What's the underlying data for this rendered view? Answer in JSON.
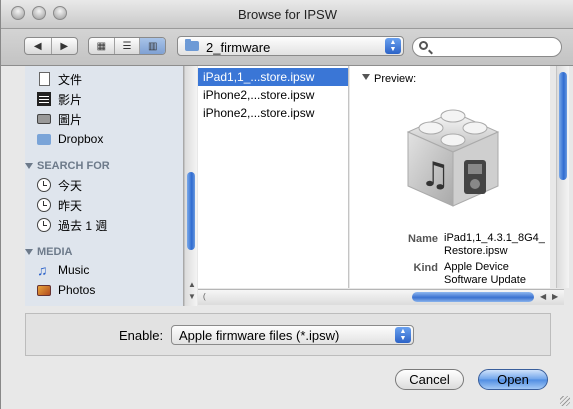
{
  "window": {
    "title": "Browse for IPSW"
  },
  "toolbar": {
    "back_icon": "chevron-left-icon",
    "forward_icon": "chevron-right-icon",
    "view_modes": [
      "icon-view",
      "list-view",
      "column-view"
    ],
    "active_view": "column-view",
    "location": "2_firmware",
    "search_placeholder": ""
  },
  "sidebar": {
    "places": [
      {
        "label": "文件",
        "icon": "document-icon"
      },
      {
        "label": "影片",
        "icon": "film-icon"
      },
      {
        "label": "圖片",
        "icon": "camera-icon"
      },
      {
        "label": "Dropbox",
        "icon": "dropbox-folder-icon"
      }
    ],
    "search_header": "SEARCH FOR",
    "search_items": [
      {
        "label": "今天",
        "icon": "clock-icon"
      },
      {
        "label": "昨天",
        "icon": "clock-icon"
      },
      {
        "label": "過去 1 週",
        "icon": "clock-icon"
      }
    ],
    "media_header": "MEDIA",
    "media_items": [
      {
        "label": "Music",
        "icon": "music-note-icon"
      },
      {
        "label": "Photos",
        "icon": "photos-icon"
      }
    ]
  },
  "files": [
    {
      "name": "iPad1,1_...store.ipsw",
      "selected": true
    },
    {
      "name": "iPhone2,...store.ipsw",
      "selected": false
    },
    {
      "name": "iPhone2,...store.ipsw",
      "selected": false
    }
  ],
  "preview": {
    "header": "Preview:",
    "name_key": "Name",
    "name_value": "iPad1,1_4.3.1_8G4_ Restore.ipsw",
    "kind_key": "Kind",
    "kind_value": "Apple Device Software Update"
  },
  "enable": {
    "label": "Enable:",
    "value": "Apple firmware files (*.ipsw)"
  },
  "buttons": {
    "cancel": "Cancel",
    "open": "Open"
  },
  "colors": {
    "selection": "#3a76d6",
    "accent_blue": "#4f8de2",
    "sidebar_bg": "#dfe5ed"
  }
}
